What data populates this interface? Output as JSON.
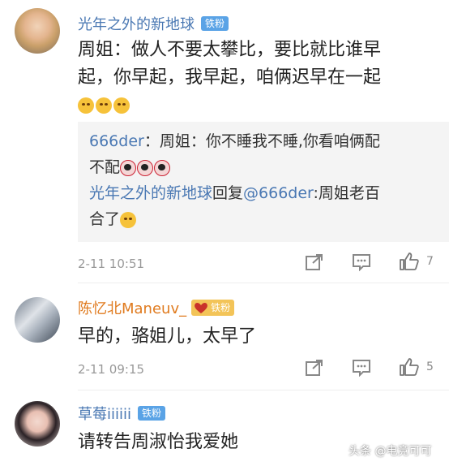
{
  "comments": [
    {
      "username": "光年之外的新地球",
      "badge": "铁粉",
      "text_line1": "周姐：做人不要太攀比，要比就比谁早",
      "text_line2": "起，你早起，我早起，咱俩迟早在一起",
      "timestamp": "2-11 10:51",
      "like_count": "7",
      "quote": {
        "author": "666der",
        "text_line1": "：周姐：你不睡我不睡,你看咱俩配",
        "text_line2": "不配",
        "reply_user": "光年之外的新地球",
        "reply_word": "回复",
        "reply_target": "@666der",
        "reply_text_line1": ":周姐老百",
        "reply_text_line2": "合了"
      }
    },
    {
      "username": "陈忆北Maneuv_",
      "badge": "铁粉",
      "text_line1": "早的，骆姐儿，太早了",
      "timestamp": "2-11 09:15",
      "like_count": "5"
    },
    {
      "username": "草莓iiiiii",
      "badge": "铁粉",
      "text_line1": "请转告周淑怡我爱她"
    }
  ],
  "watermark": "头条 @电竞可可",
  "colors": {
    "badge_blue": "#5aa3e6",
    "badge_gold": "#f3c458",
    "link_blue": "#4a78b3",
    "username_orange": "#e07b1f"
  }
}
